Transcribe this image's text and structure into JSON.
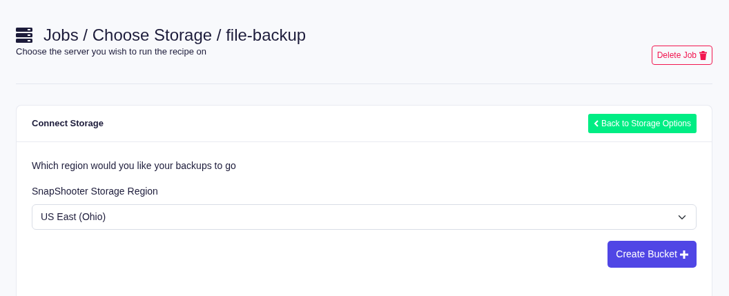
{
  "header": {
    "title": "Jobs / Choose Storage / file-backup",
    "subtitle": "Choose the server you wish to run the recipe on",
    "delete_button": "Delete Job"
  },
  "card": {
    "title": "Connect Storage",
    "back_button": "Back to Storage Options",
    "question": "Which region would you like your backups to go",
    "field_label": "SnapShooter Storage Region",
    "region_value": "US East (Ohio)",
    "submit_button": "Create Bucket"
  }
}
